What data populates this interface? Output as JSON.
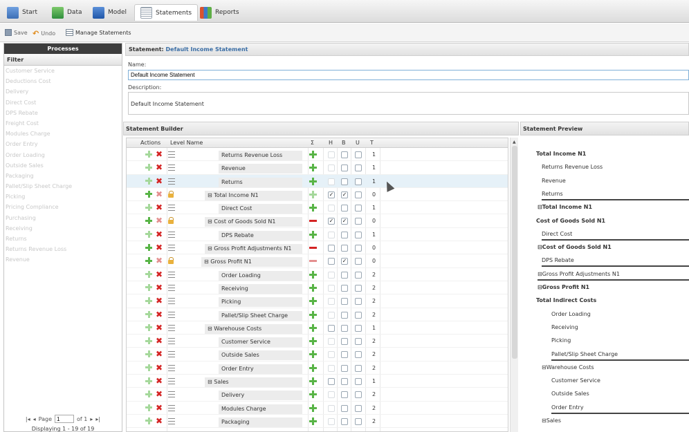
{
  "nav": {
    "tabs": [
      {
        "label": "Start",
        "icon": "start-icon",
        "color": "#4a7fc4"
      },
      {
        "label": "Data",
        "icon": "data-icon",
        "color": "#3da24a"
      },
      {
        "label": "Model",
        "icon": "model-icon",
        "color": "#2d6cc2"
      },
      {
        "label": "Statements",
        "icon": "statements-icon",
        "color": "#8a8a8a",
        "active": true
      },
      {
        "label": "Reports",
        "icon": "reports-icon",
        "color": "#c84a2d"
      }
    ]
  },
  "toolbar": {
    "save_label": "Save",
    "undo_label": "Undo",
    "manage_label": "Manage Statements"
  },
  "left": {
    "title": "Processes",
    "filter_label": "Filter",
    "items": [
      "Customer Service",
      "Deductions Cost",
      "Delivery",
      "Direct Cost",
      "DPS Rebate",
      "Freight Cost",
      "Modules Charge",
      "Order Entry",
      "Order Loading",
      "Outside Sales",
      "Packaging",
      "Pallet/Slip Sheet Charge",
      "Picking",
      "Pricing Compliance",
      "Purchasing",
      "Receiving",
      "Returns",
      "Returns Revenue Loss",
      "Revenue"
    ],
    "pager": {
      "page_label": "Page",
      "page_value": "1",
      "of_label": "of 1",
      "display": "Displaying 1 - 19 of 19"
    }
  },
  "statement": {
    "prefix": "Statement: ",
    "name": "Default Income Statement",
    "name_label": "Name:",
    "name_value": "Default Income Statement",
    "desc_label": "Description:",
    "desc_value": "Default Income Statement"
  },
  "builder": {
    "title": "Statement Builder",
    "columns": {
      "actions": "Actions",
      "level": "Level Name",
      "sigma": "Σ",
      "h": "H",
      "b": "B",
      "u": "U",
      "t": "T"
    },
    "rows": [
      {
        "name": "Returns Revenue Loss",
        "indent": 3,
        "type": "item",
        "sig": "plus",
        "h": false,
        "b": false,
        "u": false,
        "t": "1"
      },
      {
        "name": "Revenue",
        "indent": 3,
        "type": "item",
        "sig": "plus",
        "h": false,
        "b": false,
        "u": false,
        "t": "1"
      },
      {
        "name": "Returns",
        "indent": 3,
        "type": "item",
        "sig": "plus",
        "h": false,
        "b": false,
        "u": false,
        "t": "1",
        "hl": true
      },
      {
        "name": "⊟ Total Income N1",
        "indent": 2,
        "type": "group",
        "sig": "plus-light",
        "h": true,
        "b": true,
        "u": false,
        "t": "0"
      },
      {
        "name": "Direct Cost",
        "indent": 3,
        "type": "item",
        "sig": "plus",
        "h": false,
        "b": false,
        "u": false,
        "t": "1"
      },
      {
        "name": "⊟ Cost of Goods Sold N1",
        "indent": 2,
        "type": "group",
        "sig": "minus",
        "h": true,
        "b": true,
        "u": false,
        "t": "0"
      },
      {
        "name": "DPS Rebate",
        "indent": 3,
        "type": "item",
        "sig": "plus",
        "h": false,
        "b": false,
        "u": false,
        "t": "1"
      },
      {
        "name": "⊟ Gross Profit Adjustments N1",
        "indent": 2,
        "type": "groupx",
        "sig": "minus",
        "h": false,
        "b": false,
        "u": false,
        "t": "0"
      },
      {
        "name": "⊟ Gross Profit N1",
        "indent": 1,
        "type": "group",
        "sig": "minus-light",
        "h": false,
        "b": true,
        "u": false,
        "t": "0"
      },
      {
        "name": "Order Loading",
        "indent": 3,
        "type": "item",
        "sig": "plus",
        "h": false,
        "b": false,
        "u": false,
        "t": "2"
      },
      {
        "name": "Receiving",
        "indent": 3,
        "type": "item",
        "sig": "plus",
        "h": false,
        "b": false,
        "u": false,
        "t": "2"
      },
      {
        "name": "Picking",
        "indent": 3,
        "type": "item",
        "sig": "plus",
        "h": false,
        "b": false,
        "u": false,
        "t": "2"
      },
      {
        "name": "Pallet/Slip Sheet Charge",
        "indent": 3,
        "type": "item",
        "sig": "plus",
        "h": false,
        "b": false,
        "u": false,
        "t": "2"
      },
      {
        "name": "⊟ Warehouse Costs",
        "indent": 2,
        "type": "sub",
        "sig": "plus",
        "h": false,
        "b": false,
        "u": false,
        "t": "1"
      },
      {
        "name": "Customer Service",
        "indent": 3,
        "type": "item",
        "sig": "plus",
        "h": false,
        "b": false,
        "u": false,
        "t": "2"
      },
      {
        "name": "Outside Sales",
        "indent": 3,
        "type": "item",
        "sig": "plus",
        "h": false,
        "b": false,
        "u": false,
        "t": "2"
      },
      {
        "name": "Order Entry",
        "indent": 3,
        "type": "item",
        "sig": "plus",
        "h": false,
        "b": false,
        "u": false,
        "t": "2"
      },
      {
        "name": "⊟ Sales",
        "indent": 2,
        "type": "sub",
        "sig": "plus",
        "h": false,
        "b": false,
        "u": false,
        "t": "1"
      },
      {
        "name": "Delivery",
        "indent": 3,
        "type": "item",
        "sig": "plus",
        "h": false,
        "b": false,
        "u": false,
        "t": "2"
      },
      {
        "name": "Modules Charge",
        "indent": 3,
        "type": "item",
        "sig": "plus",
        "h": false,
        "b": false,
        "u": false,
        "t": "2"
      },
      {
        "name": "Packaging",
        "indent": 3,
        "type": "item",
        "sig": "plus",
        "h": false,
        "b": false,
        "u": false,
        "t": "2"
      }
    ]
  },
  "preview": {
    "title": "Statement Preview",
    "items": [
      {
        "text": "Total Income N1",
        "bold": true,
        "indent": 0,
        "line": false
      },
      {
        "text": "Returns Revenue Loss",
        "bold": false,
        "indent": 1,
        "line": false
      },
      {
        "text": "Revenue",
        "bold": false,
        "indent": 1,
        "line": false
      },
      {
        "text": "Returns",
        "bold": false,
        "indent": 1,
        "line": true
      },
      {
        "text": "⊟Total Income N1",
        "bold": true,
        "indent": 0,
        "line": false
      },
      {
        "text": "Cost of Goods Sold N1",
        "bold": true,
        "indent": -1,
        "line": false
      },
      {
        "text": "Direct Cost",
        "bold": false,
        "indent": 0,
        "line": true
      },
      {
        "text": "⊟Cost of Goods Sold N1",
        "bold": true,
        "indent": 0,
        "line": false
      },
      {
        "text": "DPS Rebate",
        "bold": false,
        "indent": 0,
        "line": true
      },
      {
        "text": "⊟Gross Profit Adjustments N1",
        "bold": false,
        "indent": 0,
        "line": true
      },
      {
        "text": "⊟Gross Profit N1",
        "bold": true,
        "indent": 0,
        "line": false
      },
      {
        "text": "Total Indirect Costs",
        "bold": true,
        "indent": 0,
        "line": false
      },
      {
        "text": "Order Loading",
        "bold": false,
        "indent": 2,
        "line": false
      },
      {
        "text": "Receiving",
        "bold": false,
        "indent": 2,
        "line": false
      },
      {
        "text": "Picking",
        "bold": false,
        "indent": 2,
        "line": false
      },
      {
        "text": "Pallet/Slip Sheet Charge",
        "bold": false,
        "indent": 2,
        "line": true
      },
      {
        "text": "⊟Warehouse Costs",
        "bold": false,
        "indent": 1,
        "line": false
      },
      {
        "text": "Customer Service",
        "bold": false,
        "indent": 2,
        "line": false
      },
      {
        "text": "Outside Sales",
        "bold": false,
        "indent": 2,
        "line": false
      },
      {
        "text": "Order Entry",
        "bold": false,
        "indent": 2,
        "line": true
      },
      {
        "text": "⊟Sales",
        "bold": false,
        "indent": 1,
        "line": false
      }
    ]
  }
}
